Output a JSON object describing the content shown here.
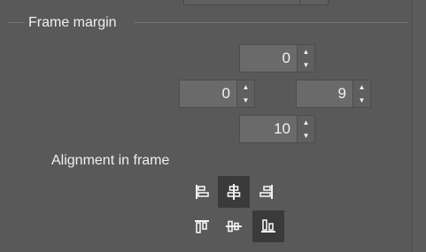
{
  "frame_margin": {
    "title": "Frame margin",
    "top": "0",
    "left": "0",
    "right": "9",
    "bottom": "10"
  },
  "alignment": {
    "label": "Alignment in frame",
    "row1": [
      {
        "name": "align-left",
        "active": false
      },
      {
        "name": "align-center-horizontal",
        "active": true
      },
      {
        "name": "align-right",
        "active": false
      }
    ],
    "row2": [
      {
        "name": "align-top",
        "active": false
      },
      {
        "name": "align-center-vertical",
        "active": false
      },
      {
        "name": "align-bottom",
        "active": true
      }
    ]
  },
  "colors": {
    "panel_bg": "#595959",
    "field_bg": "#6a6a6a",
    "active_button_bg": "#3a3a3a",
    "text": "#f0f0f0"
  }
}
